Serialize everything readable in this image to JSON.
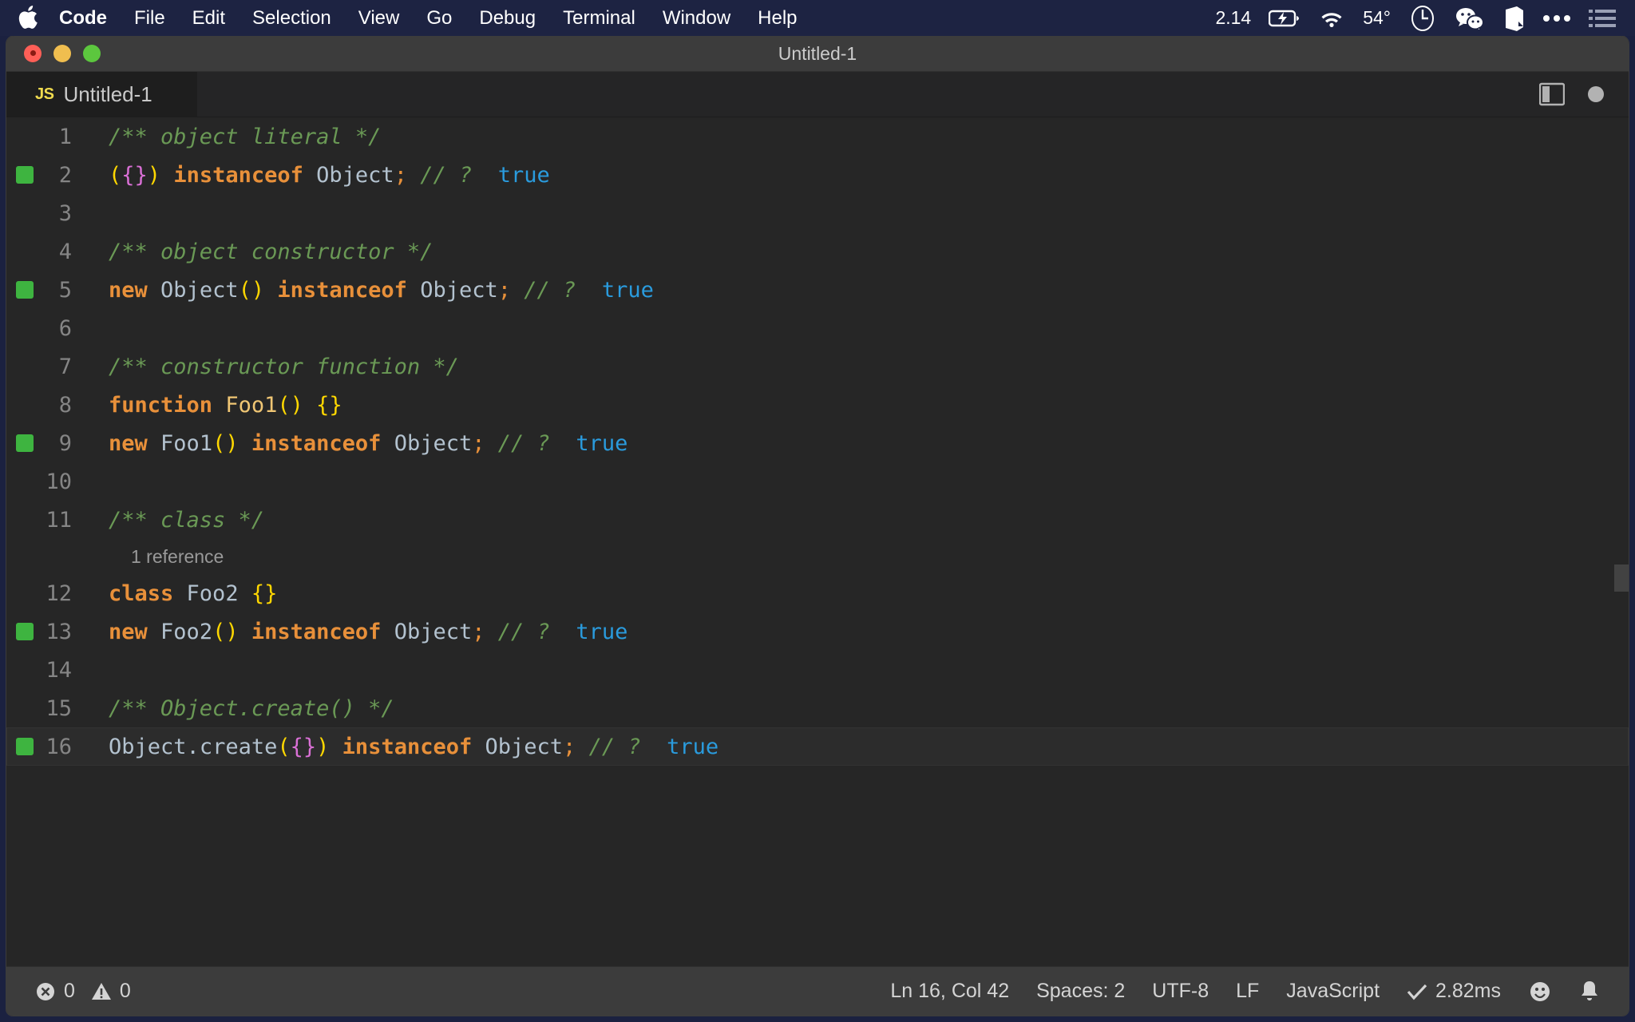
{
  "menubar": {
    "apple_icon": "apple-logo-icon",
    "items": [
      {
        "label": "Code",
        "bold": true
      },
      {
        "label": "File",
        "bold": false
      },
      {
        "label": "Edit",
        "bold": false
      },
      {
        "label": "Selection",
        "bold": false
      },
      {
        "label": "View",
        "bold": false
      },
      {
        "label": "Go",
        "bold": false
      },
      {
        "label": "Debug",
        "bold": false
      },
      {
        "label": "Terminal",
        "bold": false
      },
      {
        "label": "Window",
        "bold": false
      },
      {
        "label": "Help",
        "bold": false
      }
    ],
    "tray": {
      "time_or_value": "2.14",
      "battery_icon": "battery-charging-icon",
      "wifi_icon": "wifi-icon",
      "temperature": "54°",
      "app1_icon": "clock-circle-icon",
      "app2_icon": "wechat-icon",
      "app3_icon": "evernote-icon",
      "overflow_icon": "ellipsis-icon",
      "controlcenter_icon": "list-menu-icon"
    }
  },
  "window": {
    "title": "Untitled-1",
    "traffic_lights": [
      "close-button",
      "minimize-button",
      "maximize-button"
    ]
  },
  "tab": {
    "file_type_badge": "JS",
    "label": "Untitled-1",
    "split_editor_icon": "split-editor-icon",
    "unsaved_dot_icon": "unsaved-dot-icon"
  },
  "editor": {
    "current_line": 16,
    "lines": [
      {
        "n": 1,
        "breakpoint": false,
        "tokens": [
          {
            "t": "/** object literal */",
            "c": "t-comment"
          }
        ]
      },
      {
        "n": 2,
        "breakpoint": true,
        "tokens": [
          {
            "t": "(",
            "c": "t-paren"
          },
          {
            "t": "{}",
            "c": "t-brace-m"
          },
          {
            "t": ")",
            "c": "t-paren"
          },
          {
            "t": " ",
            "c": "t-plain"
          },
          {
            "t": "instanceof",
            "c": "t-keyword"
          },
          {
            "t": " ",
            "c": "t-plain"
          },
          {
            "t": "Object",
            "c": "t-ident"
          },
          {
            "t": ";",
            "c": "t-punct"
          },
          {
            "t": " ",
            "c": "t-plain"
          },
          {
            "t": "// ?",
            "c": "t-comment"
          },
          {
            "t": "  ",
            "c": "t-plain"
          },
          {
            "t": "true",
            "c": "t-bool"
          }
        ]
      },
      {
        "n": 3,
        "breakpoint": false,
        "tokens": []
      },
      {
        "n": 4,
        "breakpoint": false,
        "tokens": [
          {
            "t": "/** object constructor */",
            "c": "t-comment"
          }
        ]
      },
      {
        "n": 5,
        "breakpoint": true,
        "tokens": [
          {
            "t": "new",
            "c": "t-keyword"
          },
          {
            "t": " ",
            "c": "t-plain"
          },
          {
            "t": "Object",
            "c": "t-ident"
          },
          {
            "t": "()",
            "c": "t-paren"
          },
          {
            "t": " ",
            "c": "t-plain"
          },
          {
            "t": "instanceof",
            "c": "t-keyword"
          },
          {
            "t": " ",
            "c": "t-plain"
          },
          {
            "t": "Object",
            "c": "t-ident"
          },
          {
            "t": ";",
            "c": "t-punct"
          },
          {
            "t": " ",
            "c": "t-plain"
          },
          {
            "t": "// ?",
            "c": "t-comment"
          },
          {
            "t": "  ",
            "c": "t-plain"
          },
          {
            "t": "true",
            "c": "t-bool"
          }
        ]
      },
      {
        "n": 6,
        "breakpoint": false,
        "tokens": []
      },
      {
        "n": 7,
        "breakpoint": false,
        "tokens": [
          {
            "t": "/** constructor function */",
            "c": "t-comment"
          }
        ]
      },
      {
        "n": 8,
        "breakpoint": false,
        "tokens": [
          {
            "t": "function",
            "c": "t-keyword"
          },
          {
            "t": " ",
            "c": "t-plain"
          },
          {
            "t": "Foo1",
            "c": "t-fnname"
          },
          {
            "t": "()",
            "c": "t-paren"
          },
          {
            "t": " ",
            "c": "t-plain"
          },
          {
            "t": "{}",
            "c": "t-brace-y"
          }
        ]
      },
      {
        "n": 9,
        "breakpoint": true,
        "tokens": [
          {
            "t": "new",
            "c": "t-keyword"
          },
          {
            "t": " ",
            "c": "t-plain"
          },
          {
            "t": "Foo1",
            "c": "t-ident"
          },
          {
            "t": "()",
            "c": "t-paren"
          },
          {
            "t": " ",
            "c": "t-plain"
          },
          {
            "t": "instanceof",
            "c": "t-keyword"
          },
          {
            "t": " ",
            "c": "t-plain"
          },
          {
            "t": "Object",
            "c": "t-ident"
          },
          {
            "t": ";",
            "c": "t-punct"
          },
          {
            "t": " ",
            "c": "t-plain"
          },
          {
            "t": "// ?",
            "c": "t-comment"
          },
          {
            "t": "  ",
            "c": "t-plain"
          },
          {
            "t": "true",
            "c": "t-bool"
          }
        ]
      },
      {
        "n": 10,
        "breakpoint": false,
        "tokens": []
      },
      {
        "n": 11,
        "breakpoint": false,
        "tokens": [
          {
            "t": "/** class */",
            "c": "t-comment"
          }
        ],
        "codelens": "1 reference"
      },
      {
        "n": 12,
        "breakpoint": false,
        "tokens": [
          {
            "t": "class",
            "c": "t-keyword"
          },
          {
            "t": " ",
            "c": "t-plain"
          },
          {
            "t": "Foo2",
            "c": "t-ident"
          },
          {
            "t": " ",
            "c": "t-plain"
          },
          {
            "t": "{}",
            "c": "t-brace-y"
          }
        ]
      },
      {
        "n": 13,
        "breakpoint": true,
        "tokens": [
          {
            "t": "new",
            "c": "t-keyword"
          },
          {
            "t": " ",
            "c": "t-plain"
          },
          {
            "t": "Foo2",
            "c": "t-ident"
          },
          {
            "t": "()",
            "c": "t-paren"
          },
          {
            "t": " ",
            "c": "t-plain"
          },
          {
            "t": "instanceof",
            "c": "t-keyword"
          },
          {
            "t": " ",
            "c": "t-plain"
          },
          {
            "t": "Object",
            "c": "t-ident"
          },
          {
            "t": ";",
            "c": "t-punct"
          },
          {
            "t": " ",
            "c": "t-plain"
          },
          {
            "t": "// ?",
            "c": "t-comment"
          },
          {
            "t": "  ",
            "c": "t-plain"
          },
          {
            "t": "true",
            "c": "t-bool"
          }
        ]
      },
      {
        "n": 14,
        "breakpoint": false,
        "tokens": []
      },
      {
        "n": 15,
        "breakpoint": false,
        "tokens": [
          {
            "t": "/** Object.create() */",
            "c": "t-comment"
          }
        ]
      },
      {
        "n": 16,
        "breakpoint": true,
        "tokens": [
          {
            "t": "Object",
            "c": "t-ident"
          },
          {
            "t": ".",
            "c": "t-plain"
          },
          {
            "t": "create",
            "c": "t-ident"
          },
          {
            "t": "(",
            "c": "t-paren"
          },
          {
            "t": "{}",
            "c": "t-brace-m"
          },
          {
            "t": ")",
            "c": "t-paren"
          },
          {
            "t": " ",
            "c": "t-plain"
          },
          {
            "t": "instanceof",
            "c": "t-keyword"
          },
          {
            "t": " ",
            "c": "t-plain"
          },
          {
            "t": "Object",
            "c": "t-ident"
          },
          {
            "t": ";",
            "c": "t-punct"
          },
          {
            "t": " ",
            "c": "t-plain"
          },
          {
            "t": "// ?",
            "c": "t-comment"
          },
          {
            "t": "  ",
            "c": "t-plain"
          },
          {
            "t": "true",
            "c": "t-bool"
          }
        ]
      }
    ]
  },
  "statusbar": {
    "error_icon": "error-circle-icon",
    "error_count": "0",
    "warning_icon": "warning-triangle-icon",
    "warning_count": "0",
    "cursor_position": "Ln 16, Col 42",
    "indentation": "Spaces: 2",
    "encoding": "UTF-8",
    "eol": "LF",
    "language_mode": "JavaScript",
    "runtime_check_icon": "checkmark-icon",
    "runtime": "2.82ms",
    "feedback_icon": "smiley-icon",
    "notifications_icon": "bell-icon"
  },
  "colors": {
    "menubar_bg": "#1d2342",
    "titlebar_bg": "#3c3c3c",
    "editor_bg": "#262626",
    "statusbar_bg": "#3c3c3c",
    "breakpoint_green": "#3eb440",
    "comment_green": "#6a9955",
    "keyword_orange": "#e8903a",
    "bool_blue": "#2a9bdd",
    "paren_yellow": "#ffd700",
    "brace_magenta": "#da70d6",
    "js_yellow": "#f0db4f"
  }
}
